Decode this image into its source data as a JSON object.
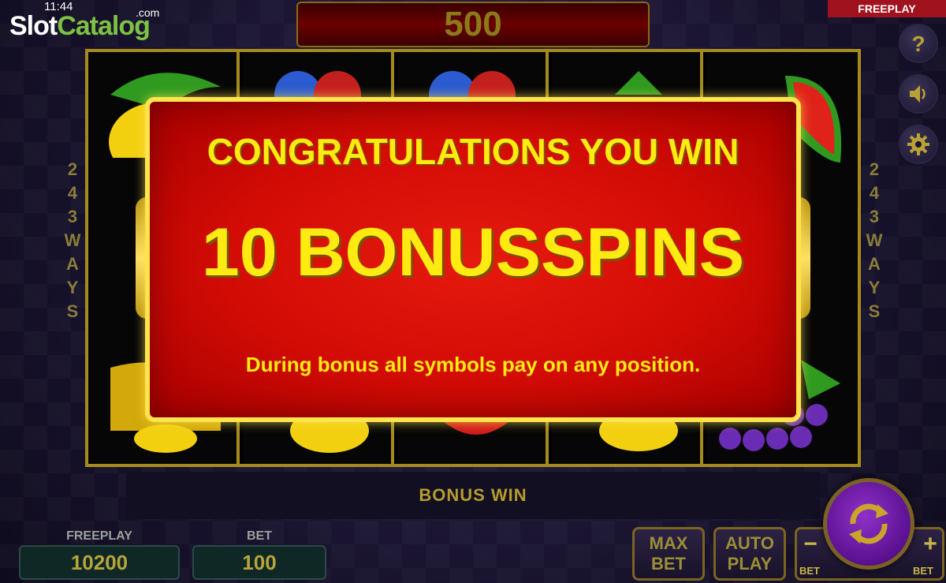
{
  "status": {
    "time": "11:44"
  },
  "brand": {
    "part1": "Slot",
    "part2": "Catalog",
    "suffix": ".com"
  },
  "top": {
    "win_amount": "500",
    "mode_flag": "FREEPLAY"
  },
  "side_buttons": [
    {
      "icon": "help-icon"
    },
    {
      "icon": "sound-icon"
    },
    {
      "icon": "settings-icon"
    }
  ],
  "ways": {
    "digits": [
      "2",
      "4",
      "3"
    ],
    "letters": [
      "W",
      "A",
      "Y",
      "S"
    ]
  },
  "reels": {
    "columns": 5,
    "visible_symbols": [
      "lemon",
      "plum",
      "cherry",
      "grapes",
      "watermelon"
    ]
  },
  "popup": {
    "title": "CONGRATULATIONS YOU WIN",
    "headline": "10 BONUSSPINS",
    "description": "During bonus all symbols pay on any position."
  },
  "bonus_bar": {
    "label": "BONUS WIN"
  },
  "balance": {
    "label": "FREEPLAY",
    "value": "10200"
  },
  "bet": {
    "label": "BET",
    "value": "100"
  },
  "buttons": {
    "max_bet": [
      "MAX",
      "BET"
    ],
    "auto_play": [
      "AUTO",
      "PLAY"
    ],
    "bet_minus": "−",
    "bet_plus": "+",
    "bet_minus_label": "BET",
    "bet_plus_label": "BET"
  },
  "colors": {
    "gold": "#fde34c",
    "popup_red": "#d20b05",
    "popup_text": "#ffeb12",
    "reel_border": "#a58a1e",
    "spin_purple": "#8f31c8"
  }
}
